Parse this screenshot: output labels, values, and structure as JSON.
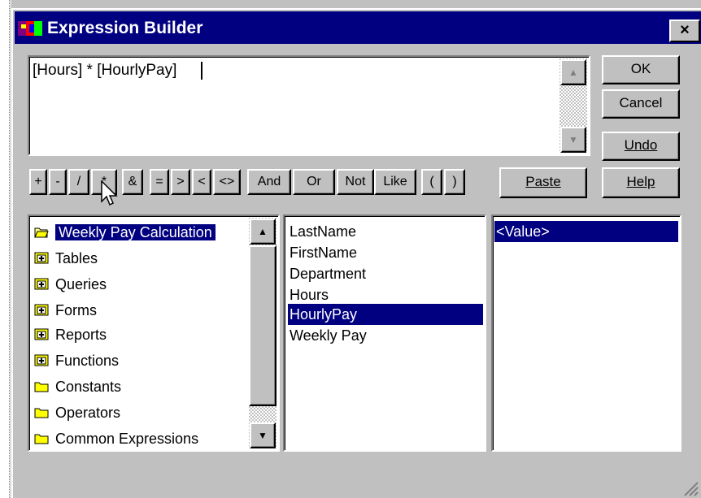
{
  "window": {
    "title": "Expression Builder",
    "close_label": "×"
  },
  "expression": {
    "text": "[Hours] * [HourlyPay]"
  },
  "buttons": {
    "ok": "OK",
    "cancel": "Cancel",
    "undo": "Undo",
    "help": "Help",
    "paste": "Paste"
  },
  "operators": [
    "+",
    "-",
    "/",
    "*",
    "&",
    "=",
    ">",
    "<",
    "<>",
    "And",
    "Or",
    "Not",
    "Like",
    "(",
    ")"
  ],
  "tree": {
    "items": [
      {
        "label": "Weekly Pay Calculation",
        "icon": "open-folder-icon",
        "selected": true
      },
      {
        "label": "Tables",
        "icon": "expand-folder-icon"
      },
      {
        "label": "Queries",
        "icon": "expand-folder-icon"
      },
      {
        "label": "Forms",
        "icon": "expand-folder-icon"
      },
      {
        "label": "Reports",
        "icon": "expand-folder-icon"
      },
      {
        "label": "Functions",
        "icon": "expand-folder-icon"
      },
      {
        "label": "Constants",
        "icon": "folder-icon"
      },
      {
        "label": "Operators",
        "icon": "folder-icon"
      },
      {
        "label": "Common Expressions",
        "icon": "folder-icon"
      }
    ]
  },
  "fields": {
    "items": [
      "LastName",
      "FirstName",
      "Department",
      "Hours",
      "HourlyPay",
      "Weekly Pay"
    ],
    "selected": "HourlyPay"
  },
  "values": {
    "items": [
      "<Value>"
    ],
    "selected": "<Value>"
  },
  "colors": {
    "titlebar": "#000080",
    "selection": "#000080",
    "face": "#c0c0c0"
  }
}
